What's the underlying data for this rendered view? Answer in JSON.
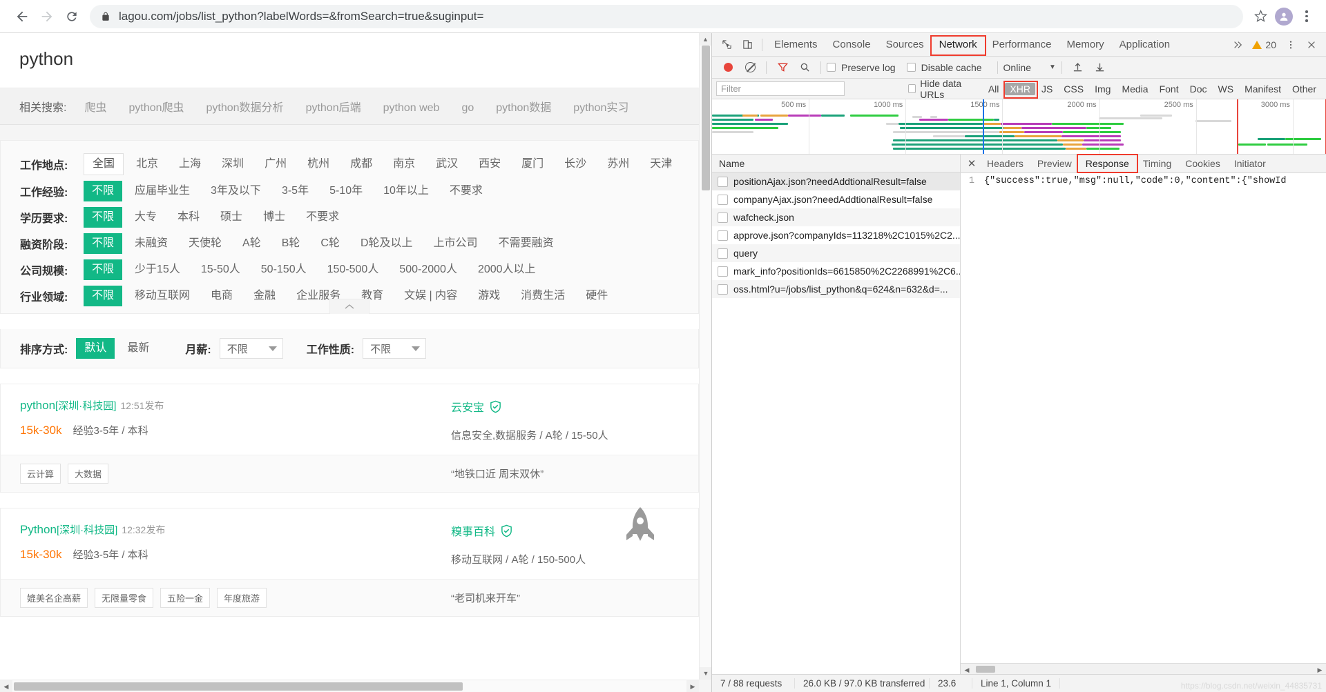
{
  "browser": {
    "url": "lagou.com/jobs/list_python?labelWords=&fromSearch=true&suginput=",
    "back_icon": "back-arrow-icon",
    "forward_icon": "forward-arrow-icon",
    "reload_icon": "reload-icon",
    "lock_icon": "lock-icon",
    "star_icon": "star-icon",
    "profile_icon": "profile-avatar-icon",
    "menu_icon": "kebab-menu-icon"
  },
  "page": {
    "search_keyword": "python",
    "related": {
      "label": "相关搜索:",
      "items": [
        "爬虫",
        "python爬虫",
        "python数据分析",
        "python后端",
        "python web",
        "go",
        "python数据",
        "python实习"
      ]
    },
    "filters": [
      {
        "name": "工作地点:",
        "selected": "全国",
        "selected_style": "box",
        "options": [
          "北京",
          "上海",
          "深圳",
          "广州",
          "杭州",
          "成都",
          "南京",
          "武汉",
          "西安",
          "厦门",
          "长沙",
          "苏州",
          "天津"
        ]
      },
      {
        "name": "工作经验:",
        "selected": "不限",
        "selected_style": "green",
        "options": [
          "应届毕业生",
          "3年及以下",
          "3-5年",
          "5-10年",
          "10年以上",
          "不要求"
        ]
      },
      {
        "name": "学历要求:",
        "selected": "不限",
        "selected_style": "green",
        "options": [
          "大专",
          "本科",
          "硕士",
          "博士",
          "不要求"
        ]
      },
      {
        "name": "融资阶段:",
        "selected": "不限",
        "selected_style": "green",
        "options": [
          "未融资",
          "天使轮",
          "A轮",
          "B轮",
          "C轮",
          "D轮及以上",
          "上市公司",
          "不需要融资"
        ]
      },
      {
        "name": "公司规模:",
        "selected": "不限",
        "selected_style": "green",
        "options": [
          "少于15人",
          "15-50人",
          "50-150人",
          "150-500人",
          "500-2000人",
          "2000人以上"
        ]
      },
      {
        "name": "行业领域:",
        "selected": "不限",
        "selected_style": "green",
        "options": [
          "移动互联网",
          "电商",
          "金融",
          "企业服务",
          "教育",
          "文娱 | 内容",
          "游戏",
          "消费生活",
          "硬件"
        ]
      }
    ],
    "collapse_icon": "chevron-up-icon",
    "sort": {
      "label": "排序方式:",
      "selected": "默认",
      "other": "最新",
      "salary_label": "月薪:",
      "salary_value": "不限",
      "jobtype_label": "工作性质:",
      "jobtype_value": "不限"
    },
    "jobs": [
      {
        "title": "python",
        "location": "[深圳·科技园]",
        "time": "12:51发布",
        "salary": "15k-30k",
        "requirement": "经验3-5年 / 本科",
        "company": "云安宝",
        "company_meta": "信息安全,数据服务 / A轮 / 15-50人",
        "tags": [
          "云计算",
          "大数据"
        ],
        "slogan": "“地铁口近 周末双休”",
        "has_rocket": false
      },
      {
        "title": "Python",
        "location": "[深圳·科技园]",
        "time": "12:32发布",
        "salary": "15k-30k",
        "requirement": "经验3-5年 / 本科",
        "company": "糗事百科",
        "company_meta": "移动互联网 / A轮 / 150-500人",
        "tags": [
          "媲美名企高薪",
          "无限量零食",
          "五险一金",
          "年度旅游"
        ],
        "slogan": "“老司机来开车”",
        "has_rocket": true
      }
    ]
  },
  "devtools": {
    "inspect_icon": "inspect-element-icon",
    "device_icon": "device-toolbar-icon",
    "tabs": [
      "Elements",
      "Console",
      "Sources",
      "Network",
      "Performance",
      "Memory",
      "Application"
    ],
    "active_tab": "Network",
    "more_tabs_icon": "chevron-double-right-icon",
    "warning_count": "20",
    "warning_icon": "warning-triangle-icon",
    "settings_icon": "gear-icon",
    "close_icon": "close-icon",
    "toolbar": {
      "record_icon": "record-stop-icon",
      "clear_icon": "clear-icon",
      "filter_icon": "filter-funnel-icon",
      "search_icon": "search-icon",
      "preserve_log": "Preserve log",
      "disable_cache": "Disable cache",
      "throttle": "Online",
      "throttle_caret_icon": "chevron-down-icon",
      "import_icon": "import-har-icon",
      "export_icon": "export-har-icon"
    },
    "filterbar": {
      "filter_placeholder": "Filter",
      "hide_data_urls": "Hide data URLs",
      "types": [
        "All",
        "XHR",
        "JS",
        "CSS",
        "Img",
        "Media",
        "Font",
        "Doc",
        "WS",
        "Manifest",
        "Other"
      ],
      "active_type": "XHR"
    },
    "waterfall": {
      "ticks": [
        "500 ms",
        "1000 ms",
        "1500 ms",
        "2000 ms",
        "2500 ms",
        "3000 ms"
      ]
    },
    "requests": {
      "header": "Name",
      "rows": [
        "positionAjax.json?needAddtionalResult=false",
        "companyAjax.json?needAddtionalResult=false",
        "wafcheck.json",
        "approve.json?companyIds=113218%2C1015%2C2...",
        "query",
        "mark_info?positionIds=6615850%2C2268991%2C6...",
        "oss.html?u=/jobs/list_python&q=624&n=632&d=..."
      ],
      "selected_index": 0
    },
    "detail_tabs": [
      "Headers",
      "Preview",
      "Response",
      "Timing",
      "Cookies",
      "Initiator"
    ],
    "active_detail_tab": "Response",
    "response": {
      "line_number": "1",
      "body": "{\"success\":true,\"msg\":null,\"code\":0,\"content\":{\"showId"
    },
    "status": {
      "requests": "7 / 88 requests",
      "transferred": "26.0 KB / 97.0 KB transferred",
      "resources": "23.6",
      "cursor": "Line 1, Column 1"
    },
    "watermark": "https://blog.csdn.net/weixin_44835731"
  },
  "colors": {
    "accent_green": "#12b886",
    "salary_orange": "#ff7300",
    "highlight_red": "#ef3b2d",
    "devtools_bg": "#f3f3f3"
  }
}
